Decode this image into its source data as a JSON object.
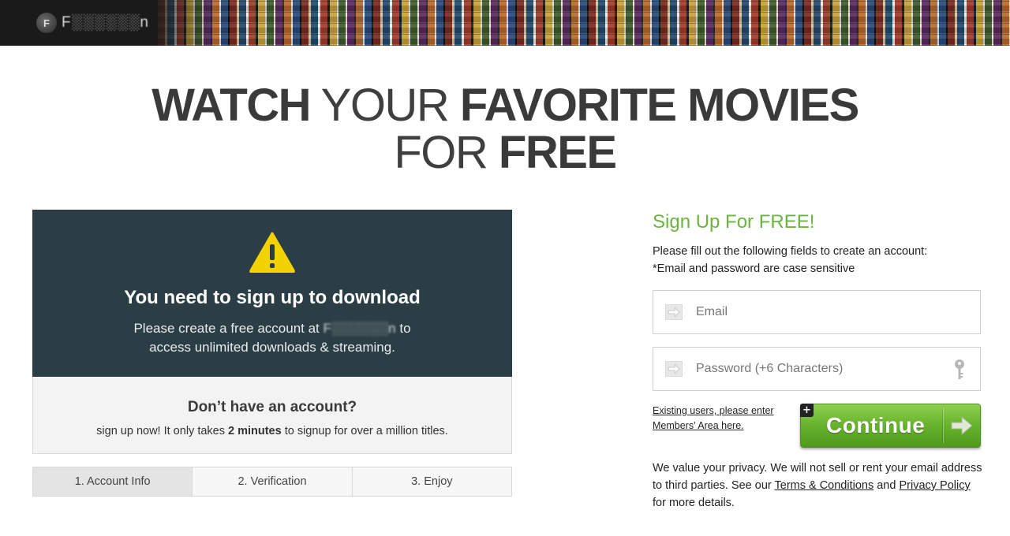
{
  "header": {
    "logo_mark": "F",
    "logo_text": "F░░░░░░n"
  },
  "headline": {
    "line1_part1": "WATCH",
    "line1_part2": " YOUR ",
    "line1_part3": "FAVORITE MOVIES",
    "line2_part1": "FOR ",
    "line2_part2": "FREE"
  },
  "warning": {
    "title": "You need to sign up to download",
    "text_before": "Please create a free account at ",
    "site_name": "F░░░░░░n",
    "text_after": " to",
    "text_line2": "access unlimited downloads & streaming."
  },
  "account": {
    "title": "Don’t have an account?",
    "text_before": "sign up now! It only takes ",
    "text_bold": "2 minutes",
    "text_after": " to signup for over a million titles."
  },
  "steps": [
    {
      "label": "1. Account Info"
    },
    {
      "label": "2. Verification"
    },
    {
      "label": "3. Enjoy"
    }
  ],
  "signup": {
    "title": "Sign Up For FREE!",
    "desc_line1": "Please fill out the following fields to create an account:",
    "desc_line2": "*Email and password are case sensitive",
    "email_placeholder": "Email",
    "password_placeholder": "Password (+6 Characters)",
    "existing_link": "Existing users, please enter Members' Area here.",
    "continue_label": "Continue",
    "plus_badge": "+",
    "privacy_before": "We value your privacy. We will not sell or rent your email address to third parties. See our ",
    "terms_link": "Terms & Conditions",
    "privacy_mid": " and ",
    "privacy_link": "Privacy Policy",
    "privacy_after": " for more details."
  },
  "colors": {
    "accent_green": "#6db33f",
    "card_dark": "#2c3e45",
    "warning_yellow": "#f2d200"
  }
}
